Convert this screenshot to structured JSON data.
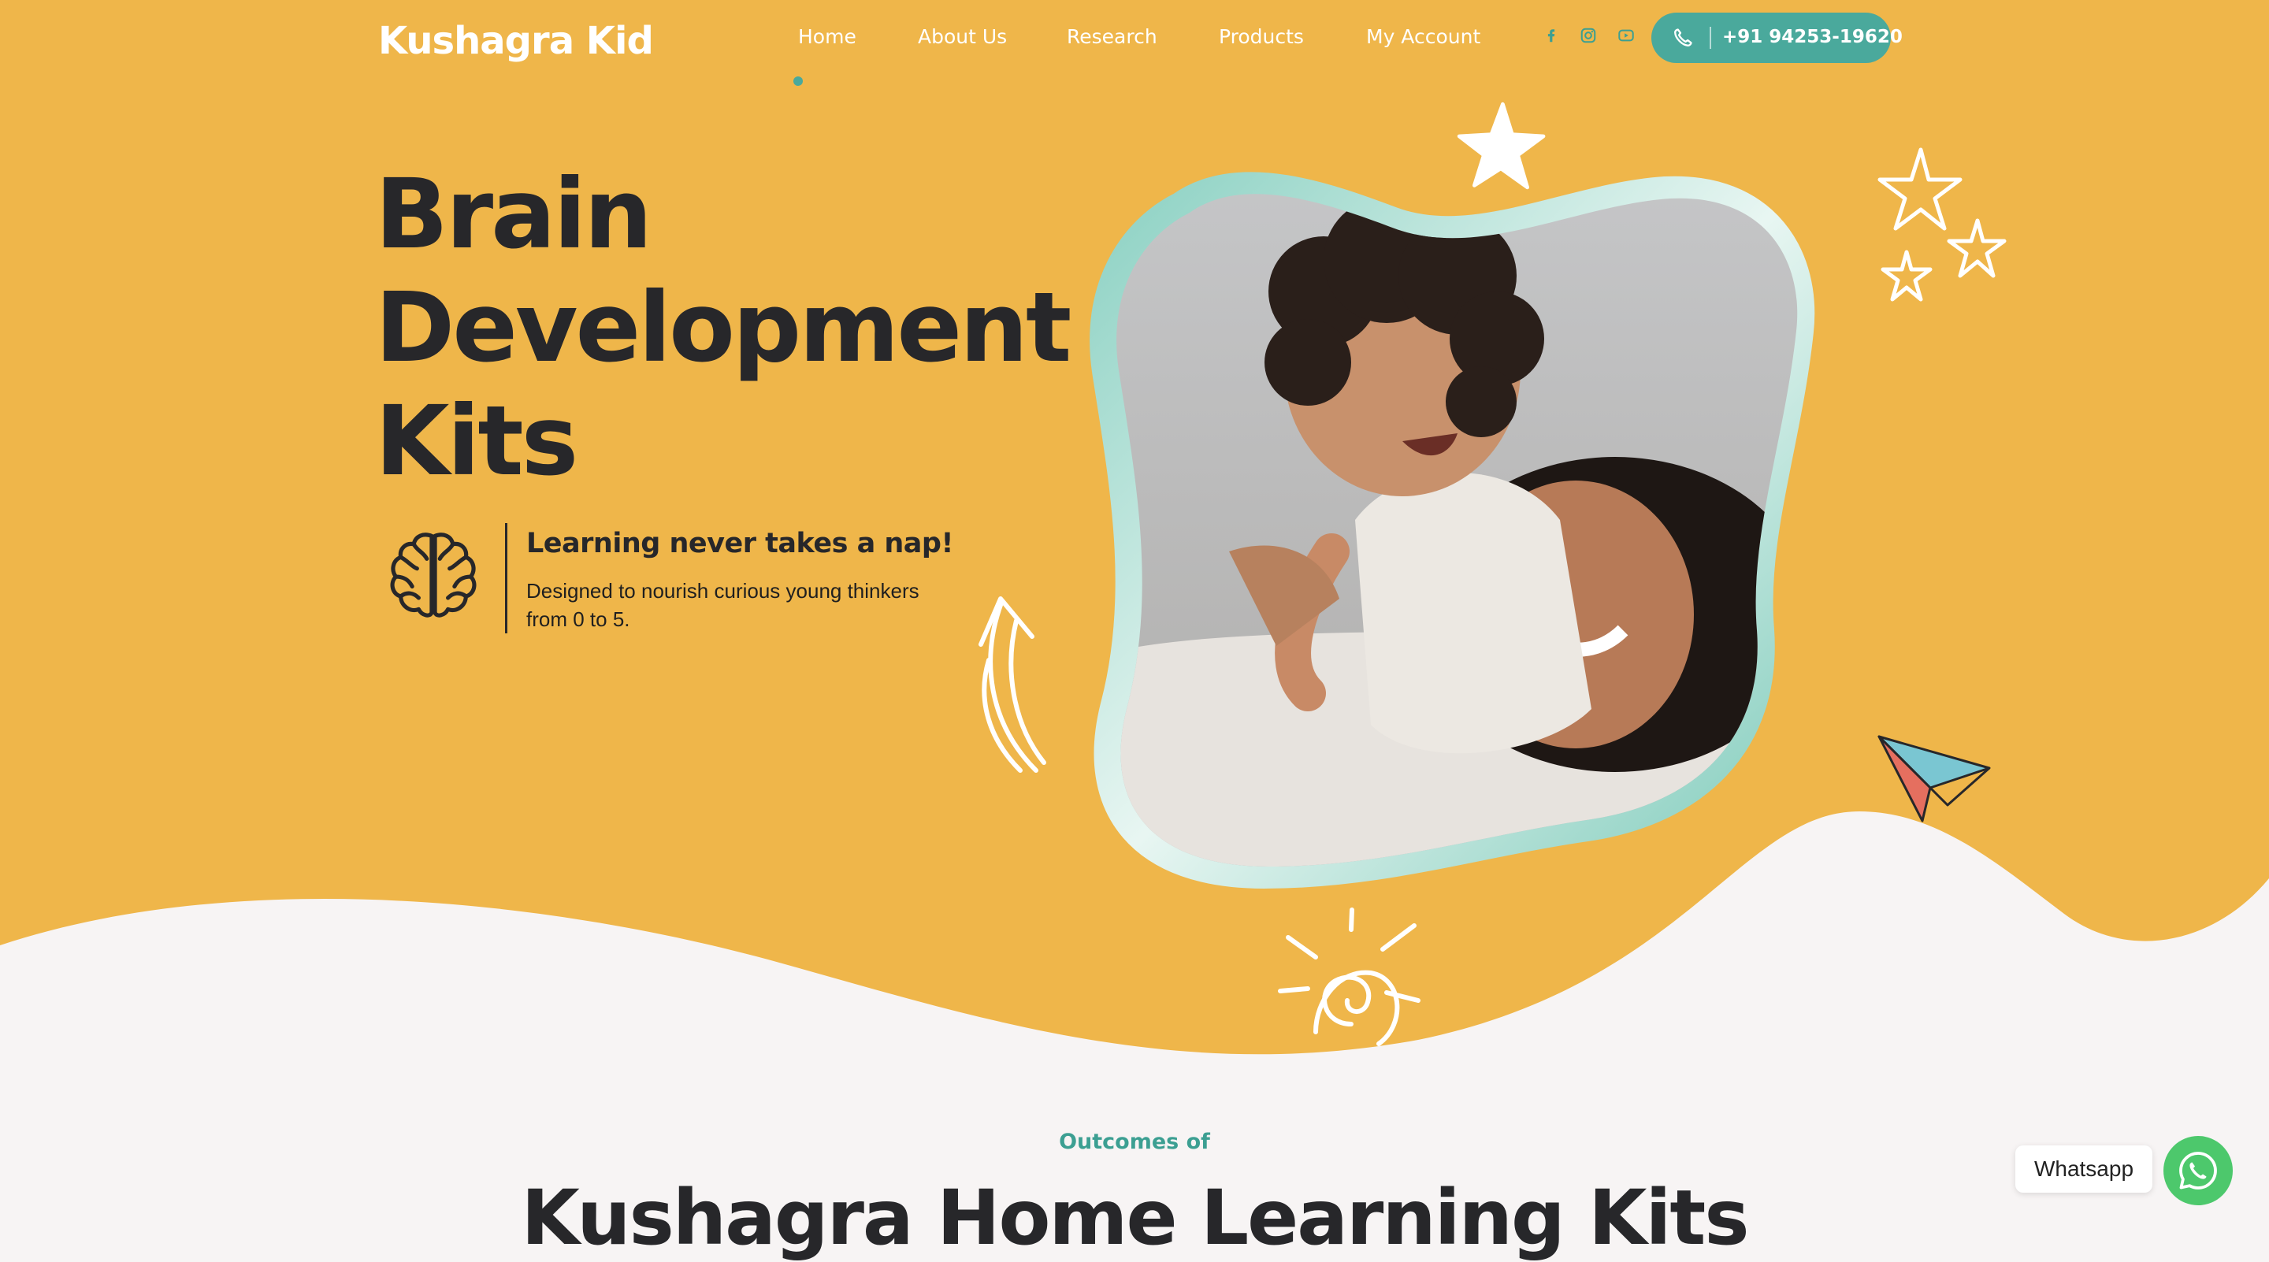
{
  "header": {
    "logo": "Kushagra Kid",
    "nav": [
      {
        "label": "Home",
        "active": true
      },
      {
        "label": "About Us",
        "active": false
      },
      {
        "label": "Research",
        "active": false
      },
      {
        "label": "Products",
        "active": false
      },
      {
        "label": "My Account",
        "active": false
      }
    ],
    "social_icons": [
      "facebook-icon",
      "instagram-icon",
      "youtube-icon"
    ],
    "phone": {
      "icon": "phone-icon",
      "number": "+91 94253-19620"
    }
  },
  "hero": {
    "title_lines": [
      "Brain",
      "Development",
      "Kits"
    ],
    "feature_icon": "brain-icon",
    "tagline": "Learning never takes a nap!",
    "description": "Designed to nourish curious young thinkers from 0 to 5."
  },
  "section": {
    "label": "Outcomes of",
    "title": "Kushagra Home Learning Kits"
  },
  "whatsapp": {
    "label": "Whatsapp",
    "icon": "whatsapp-icon"
  },
  "colors": {
    "hero_bg": "#efb64a",
    "accent": "#4aa99c",
    "text_dark": "#27272a",
    "page_bg": "#f7f4f4",
    "whatsapp": "#4dc86c"
  }
}
